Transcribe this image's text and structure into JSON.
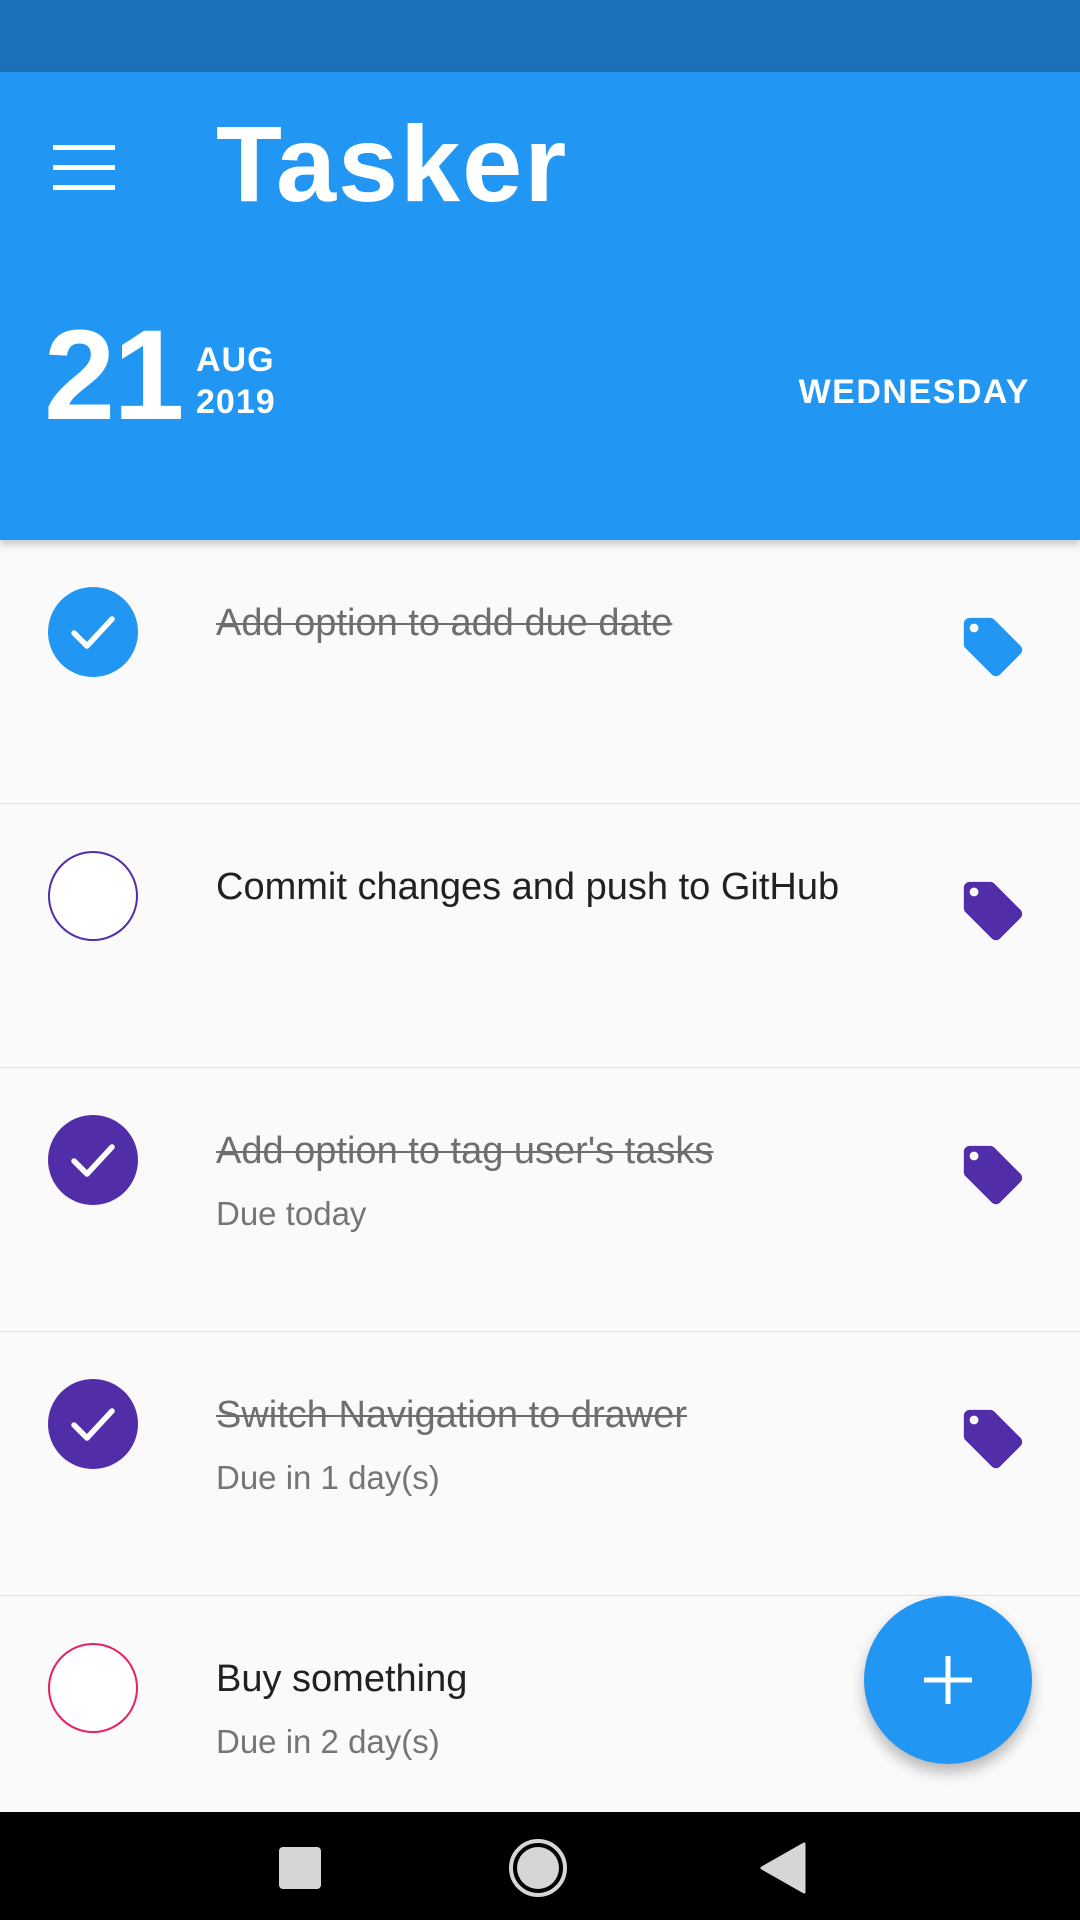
{
  "header": {
    "app_title": "Tasker",
    "menu_icon": "hamburger-menu-icon",
    "date_day": "21",
    "date_month": "AUG",
    "date_year": "2019",
    "weekday": "WEDNESDAY"
  },
  "colors": {
    "status_bar": "#1c72b8",
    "primary": "#2196f3",
    "purple": "#512da8",
    "pink": "#e91e63",
    "background": "#fafafa"
  },
  "tasks": [
    {
      "title": "Add option to add due date",
      "due": "",
      "completed": true,
      "color": "#2196f3",
      "tag_icon": "tag-icon"
    },
    {
      "title": "Commit changes and push to GitHub",
      "due": "",
      "completed": false,
      "color": "#512da8",
      "tag_icon": "tag-icon"
    },
    {
      "title": "Add option to tag user's tasks",
      "due": "Due today",
      "completed": true,
      "color": "#512da8",
      "tag_icon": "tag-icon"
    },
    {
      "title": "Switch Navigation to drawer",
      "due": "Due in 1 day(s)",
      "completed": true,
      "color": "#512da8",
      "tag_icon": "tag-icon"
    },
    {
      "title": "Buy something",
      "due": "Due in 2 day(s)",
      "completed": false,
      "color": "#e91e63",
      "tag_icon": "tag-icon"
    }
  ],
  "fab": {
    "icon": "plus-icon"
  },
  "nav_bar": {
    "recents_icon": "square-icon",
    "home_icon": "circle-icon",
    "back_icon": "triangle-back-icon"
  }
}
